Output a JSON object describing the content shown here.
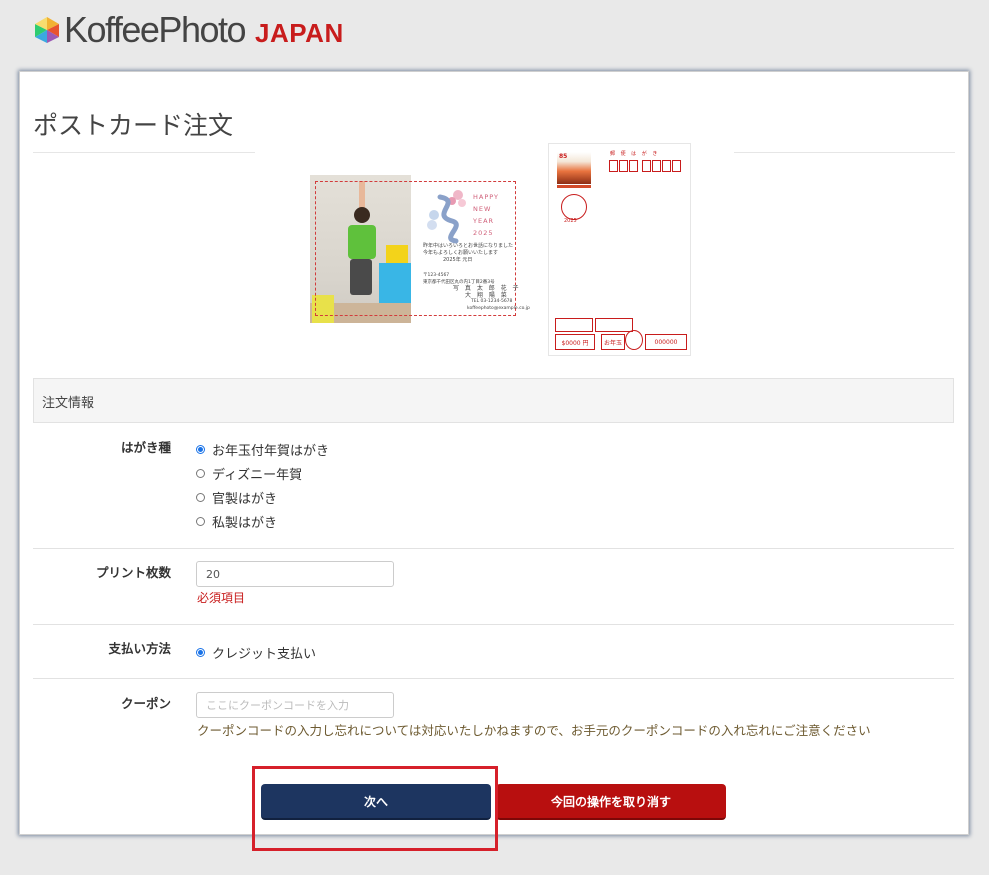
{
  "logo": {
    "text": "KoffeePhoto",
    "region": "JAPAN"
  },
  "page": {
    "title": "ポストカード注文"
  },
  "postcard_front": {
    "greeting_title": [
      "HAPPY",
      "NEW",
      "YEAR",
      "2025"
    ],
    "message": [
      "昨年中はいろいろとお世話になりました",
      "今年もよろしくお願いいたします",
      "2025年  元日"
    ],
    "address": [
      "〒123-4567",
      "東京都千代田区丸の内1丁目2番3号",
      "写 真  太 郎  花 子",
      "大 翔  陽 菜",
      "TEL 03-1234-5678",
      "koffeephoto@example.co.jp"
    ]
  },
  "postcard_back": {
    "stamp_value": "85",
    "label": "郵 便 は が き",
    "postmark_year": "2025",
    "lottery_amount": "$0000 円",
    "lottery_label": "お年玉",
    "lottery_number": "000000"
  },
  "order": {
    "section_title": "注文情報",
    "card_type": {
      "label": "はがき種",
      "options": [
        "お年玉付年賀はがき",
        "ディズニー年賀",
        "官製はがき",
        "私製はがき"
      ],
      "selected_index": 0
    },
    "print_count": {
      "label": "プリント枚数",
      "value": "20",
      "required_note": "必須項目"
    },
    "payment": {
      "label": "支払い方法",
      "option": "クレジット支払い"
    },
    "coupon": {
      "label": "クーポン",
      "placeholder": "ここにクーポンコードを入力",
      "note": "クーポンコードの入力し忘れについては対応いたしかねますので、お手元のクーポンコードの入れ忘れにご注意ください"
    }
  },
  "buttons": {
    "next": "次へ",
    "cancel": "今回の操作を取り消す"
  },
  "colors": {
    "brand_red": "#c81c1c",
    "next_button": "#1d3560",
    "cancel_button": "#b80f0f",
    "radio_blue": "#1a73e8",
    "highlight_red": "#d6202a"
  }
}
